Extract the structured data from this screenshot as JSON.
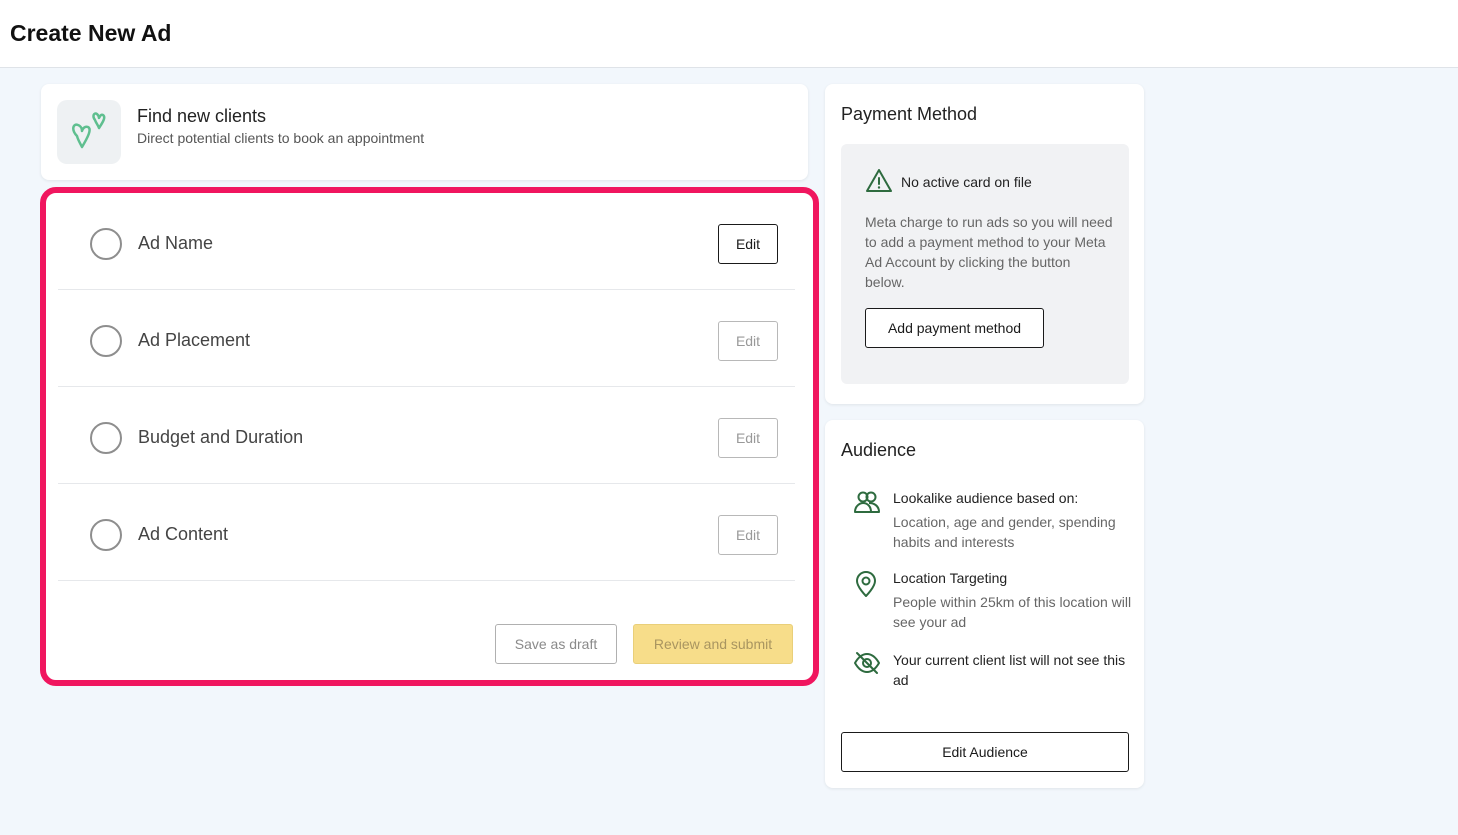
{
  "header": {
    "title": "Create New Ad"
  },
  "objective": {
    "title": "Find new clients",
    "description": "Direct potential clients to book an appointment",
    "logo_color": "#5fbf8f"
  },
  "steps": [
    {
      "label": "Ad Name",
      "edit_label": "Edit",
      "edit_enabled": true
    },
    {
      "label": "Ad Placement",
      "edit_label": "Edit",
      "edit_enabled": false
    },
    {
      "label": "Budget and Duration",
      "edit_label": "Edit",
      "edit_enabled": false
    },
    {
      "label": "Ad Content",
      "edit_label": "Edit",
      "edit_enabled": false
    }
  ],
  "actions": {
    "save_draft_label": "Save as draft",
    "review_submit_label": "Review and submit"
  },
  "payment": {
    "title": "Payment Method",
    "warning": "No active card on file",
    "description": "Meta charge to run ads so you will need to add a payment method to your Meta Ad Account by clicking the button below.",
    "button_label": "Add payment method"
  },
  "audience": {
    "title": "Audience",
    "items": [
      {
        "icon": "users-icon",
        "title": "Lookalike audience based on:",
        "description": "Location, age and gender, spending habits and interests"
      },
      {
        "icon": "location-pin-icon",
        "title": "Location Targeting",
        "description": "People within 25km of this location will see your ad"
      },
      {
        "icon": "eye-off-icon",
        "title": "Your current client list will not see this ad",
        "description": ""
      }
    ],
    "button_label": "Edit Audience"
  },
  "colors": {
    "highlight_border": "#f0165f",
    "icon_green": "#2e6b3f",
    "submit_yellow": "#f7dd8a"
  }
}
